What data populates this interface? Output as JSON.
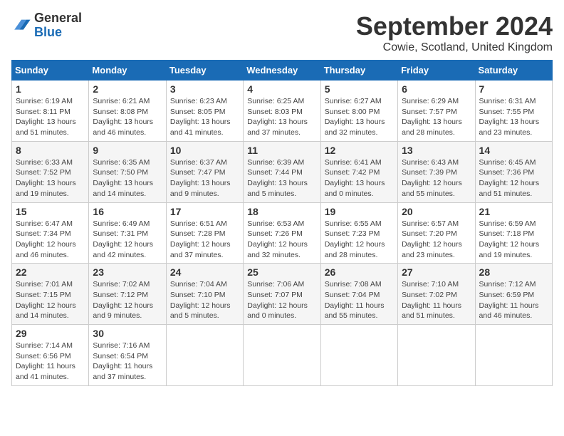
{
  "header": {
    "logo": {
      "line1": "General",
      "line2": "Blue"
    },
    "title": "September 2024",
    "location": "Cowie, Scotland, United Kingdom"
  },
  "weekdays": [
    "Sunday",
    "Monday",
    "Tuesday",
    "Wednesday",
    "Thursday",
    "Friday",
    "Saturday"
  ],
  "weeks": [
    [
      {
        "day": "1",
        "info": "Sunrise: 6:19 AM\nSunset: 8:11 PM\nDaylight: 13 hours\nand 51 minutes."
      },
      {
        "day": "2",
        "info": "Sunrise: 6:21 AM\nSunset: 8:08 PM\nDaylight: 13 hours\nand 46 minutes."
      },
      {
        "day": "3",
        "info": "Sunrise: 6:23 AM\nSunset: 8:05 PM\nDaylight: 13 hours\nand 41 minutes."
      },
      {
        "day": "4",
        "info": "Sunrise: 6:25 AM\nSunset: 8:03 PM\nDaylight: 13 hours\nand 37 minutes."
      },
      {
        "day": "5",
        "info": "Sunrise: 6:27 AM\nSunset: 8:00 PM\nDaylight: 13 hours\nand 32 minutes."
      },
      {
        "day": "6",
        "info": "Sunrise: 6:29 AM\nSunset: 7:57 PM\nDaylight: 13 hours\nand 28 minutes."
      },
      {
        "day": "7",
        "info": "Sunrise: 6:31 AM\nSunset: 7:55 PM\nDaylight: 13 hours\nand 23 minutes."
      }
    ],
    [
      {
        "day": "8",
        "info": "Sunrise: 6:33 AM\nSunset: 7:52 PM\nDaylight: 13 hours\nand 19 minutes."
      },
      {
        "day": "9",
        "info": "Sunrise: 6:35 AM\nSunset: 7:50 PM\nDaylight: 13 hours\nand 14 minutes."
      },
      {
        "day": "10",
        "info": "Sunrise: 6:37 AM\nSunset: 7:47 PM\nDaylight: 13 hours\nand 9 minutes."
      },
      {
        "day": "11",
        "info": "Sunrise: 6:39 AM\nSunset: 7:44 PM\nDaylight: 13 hours\nand 5 minutes."
      },
      {
        "day": "12",
        "info": "Sunrise: 6:41 AM\nSunset: 7:42 PM\nDaylight: 13 hours\nand 0 minutes."
      },
      {
        "day": "13",
        "info": "Sunrise: 6:43 AM\nSunset: 7:39 PM\nDaylight: 12 hours\nand 55 minutes."
      },
      {
        "day": "14",
        "info": "Sunrise: 6:45 AM\nSunset: 7:36 PM\nDaylight: 12 hours\nand 51 minutes."
      }
    ],
    [
      {
        "day": "15",
        "info": "Sunrise: 6:47 AM\nSunset: 7:34 PM\nDaylight: 12 hours\nand 46 minutes."
      },
      {
        "day": "16",
        "info": "Sunrise: 6:49 AM\nSunset: 7:31 PM\nDaylight: 12 hours\nand 42 minutes."
      },
      {
        "day": "17",
        "info": "Sunrise: 6:51 AM\nSunset: 7:28 PM\nDaylight: 12 hours\nand 37 minutes."
      },
      {
        "day": "18",
        "info": "Sunrise: 6:53 AM\nSunset: 7:26 PM\nDaylight: 12 hours\nand 32 minutes."
      },
      {
        "day": "19",
        "info": "Sunrise: 6:55 AM\nSunset: 7:23 PM\nDaylight: 12 hours\nand 28 minutes."
      },
      {
        "day": "20",
        "info": "Sunrise: 6:57 AM\nSunset: 7:20 PM\nDaylight: 12 hours\nand 23 minutes."
      },
      {
        "day": "21",
        "info": "Sunrise: 6:59 AM\nSunset: 7:18 PM\nDaylight: 12 hours\nand 19 minutes."
      }
    ],
    [
      {
        "day": "22",
        "info": "Sunrise: 7:01 AM\nSunset: 7:15 PM\nDaylight: 12 hours\nand 14 minutes."
      },
      {
        "day": "23",
        "info": "Sunrise: 7:02 AM\nSunset: 7:12 PM\nDaylight: 12 hours\nand 9 minutes."
      },
      {
        "day": "24",
        "info": "Sunrise: 7:04 AM\nSunset: 7:10 PM\nDaylight: 12 hours\nand 5 minutes."
      },
      {
        "day": "25",
        "info": "Sunrise: 7:06 AM\nSunset: 7:07 PM\nDaylight: 12 hours\nand 0 minutes."
      },
      {
        "day": "26",
        "info": "Sunrise: 7:08 AM\nSunset: 7:04 PM\nDaylight: 11 hours\nand 55 minutes."
      },
      {
        "day": "27",
        "info": "Sunrise: 7:10 AM\nSunset: 7:02 PM\nDaylight: 11 hours\nand 51 minutes."
      },
      {
        "day": "28",
        "info": "Sunrise: 7:12 AM\nSunset: 6:59 PM\nDaylight: 11 hours\nand 46 minutes."
      }
    ],
    [
      {
        "day": "29",
        "info": "Sunrise: 7:14 AM\nSunset: 6:56 PM\nDaylight: 11 hours\nand 41 minutes."
      },
      {
        "day": "30",
        "info": "Sunrise: 7:16 AM\nSunset: 6:54 PM\nDaylight: 11 hours\nand 37 minutes."
      },
      null,
      null,
      null,
      null,
      null
    ]
  ]
}
